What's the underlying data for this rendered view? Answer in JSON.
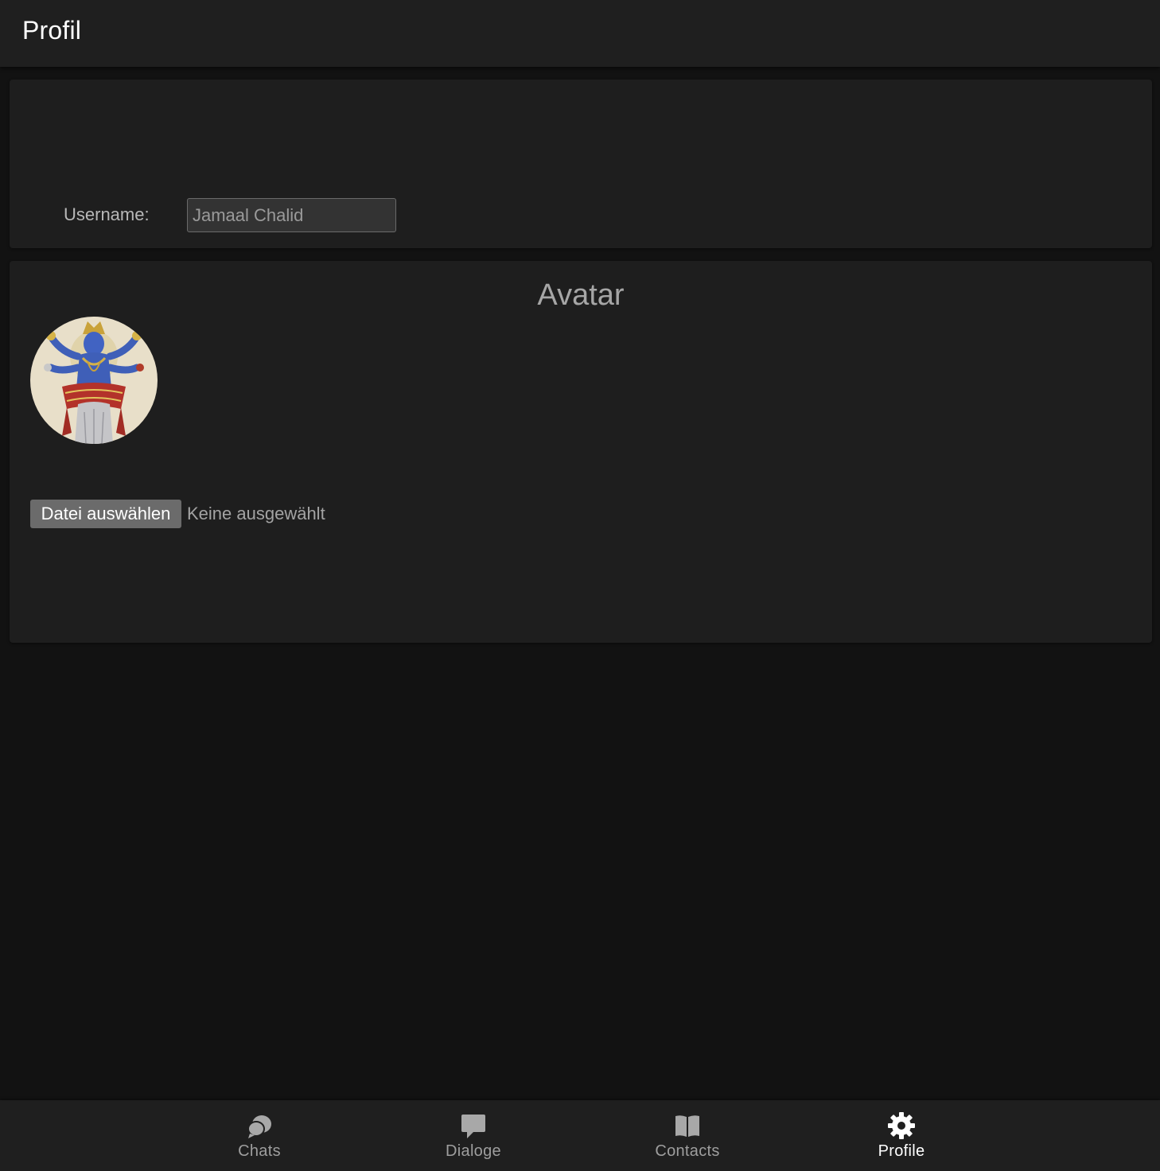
{
  "header": {
    "title": "Profil"
  },
  "user": {
    "label": "Username:",
    "value": "Jamaal Chalid"
  },
  "avatar": {
    "heading": "Avatar",
    "file_button": "Datei auswählen",
    "file_status": "Keine ausgewählt"
  },
  "tabs": [
    {
      "label": "Chats",
      "icon": "chats-icon",
      "active": false
    },
    {
      "label": "Dialoge",
      "icon": "chat-bubble-icon",
      "active": false
    },
    {
      "label": "Contacts",
      "icon": "book-icon",
      "active": false
    },
    {
      "label": "Profile",
      "icon": "gear-icon",
      "active": true
    }
  ],
  "colors": {
    "background": "#121212",
    "surface": "#1e1e1e",
    "toolbar": "#1f1f1f",
    "active_tab": "#ffffff",
    "inactive_tab": "#9e9e9e"
  }
}
